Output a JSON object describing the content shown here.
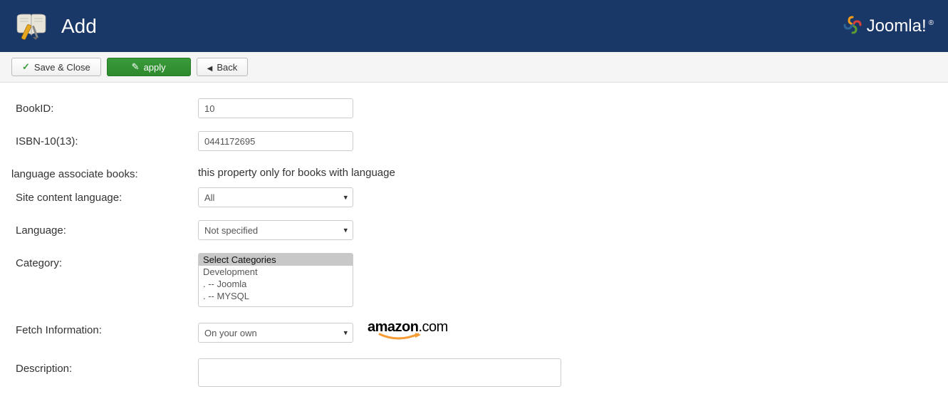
{
  "header": {
    "title": "Add",
    "brand": "Joomla!"
  },
  "toolbar": {
    "save_close": "Save & Close",
    "apply": "apply",
    "back": "Back"
  },
  "form": {
    "bookid": {
      "label": "BookID:",
      "value": "10"
    },
    "isbn": {
      "label": "ISBN-10(13):",
      "value": "0441172695"
    },
    "assoc": {
      "label": "language associate books:",
      "hint": "this property only for books with language"
    },
    "sitelang": {
      "label": "Site content language:",
      "value": "All"
    },
    "language": {
      "label": "Language:",
      "value": "Not specified"
    },
    "category": {
      "label": "Category:",
      "options": [
        "Select Categories",
        "Development",
        ". -- Joomla",
        ". -- MYSQL"
      ]
    },
    "fetch": {
      "label": "Fetch Information:",
      "value": "On your own"
    },
    "description": {
      "label": "Description:",
      "value": ""
    }
  },
  "amazon": {
    "part1": "amazon",
    "part2": ".com"
  }
}
